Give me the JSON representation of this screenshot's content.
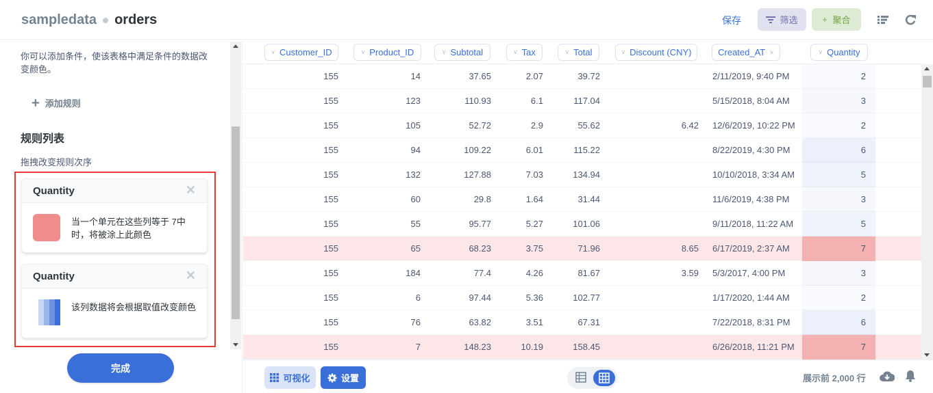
{
  "header": {
    "database": "sampledata",
    "table": "orders",
    "save_label": "保存",
    "filter_label": "筛选",
    "aggregate_label": "聚合",
    "icons": [
      "filter-icon",
      "plus-icon",
      "list-icon",
      "refresh-icon"
    ]
  },
  "sidebar": {
    "description": "你可以添加条件，使该表格中满足条件的数据改变颜色。",
    "add_rule_label": "添加规则",
    "rules_title": "规则列表",
    "rules_subtitle": "拖拽改变规则次序",
    "rules": [
      {
        "column": "Quantity",
        "type": "single",
        "color": "#ef8c8c",
        "text": "当一个单元在这些列等于 7中时，将被涂上此颜色"
      },
      {
        "column": "Quantity",
        "type": "range",
        "colors": [
          "#ffffff",
          "#c8d6f3",
          "#9db6ea",
          "#6e92df",
          "#3a6fd9"
        ],
        "text": "该列数据将会根据取值改变颜色"
      }
    ],
    "done_label": "完成"
  },
  "table": {
    "columns": [
      {
        "key": "customer_id",
        "label": "Customer_ID"
      },
      {
        "key": "product_id",
        "label": "Product_ID"
      },
      {
        "key": "subtotal",
        "label": "Subtotal"
      },
      {
        "key": "tax",
        "label": "Tax"
      },
      {
        "key": "total",
        "label": "Total"
      },
      {
        "key": "discount",
        "label": "Discount (CNY)"
      },
      {
        "key": "created_at",
        "label": "Created_AT"
      },
      {
        "key": "quantity",
        "label": "Quantity"
      }
    ],
    "highlight_color": "#fce6e7",
    "highlight_cell_color": "#f3b1b2",
    "rows": [
      [
        "155",
        "14",
        "37.65",
        "2.07",
        "39.72",
        "",
        "2/11/2019, 9:40 PM",
        "2"
      ],
      [
        "155",
        "123",
        "110.93",
        "6.1",
        "117.04",
        "",
        "5/15/2018, 8:04 AM",
        "3"
      ],
      [
        "155",
        "105",
        "52.72",
        "2.9",
        "55.62",
        "6.42",
        "12/6/2019, 10:22 PM",
        "2"
      ],
      [
        "155",
        "94",
        "109.22",
        "6.01",
        "115.22",
        "",
        "8/22/2019, 4:30 PM",
        "6"
      ],
      [
        "155",
        "132",
        "127.88",
        "7.03",
        "134.94",
        "",
        "10/10/2018, 3:34 AM",
        "5"
      ],
      [
        "155",
        "60",
        "29.8",
        "1.64",
        "31.44",
        "",
        "11/6/2019, 4:38 PM",
        "3"
      ],
      [
        "155",
        "55",
        "95.77",
        "5.27",
        "101.06",
        "",
        "9/11/2018, 11:22 AM",
        "5"
      ],
      [
        "155",
        "65",
        "68.23",
        "3.75",
        "71.96",
        "8.65",
        "6/17/2019, 2:37 AM",
        "7"
      ],
      [
        "155",
        "184",
        "77.4",
        "4.26",
        "81.67",
        "3.59",
        "5/3/2017, 4:00 PM",
        "3"
      ],
      [
        "155",
        "6",
        "97.44",
        "5.36",
        "102.77",
        "",
        "1/17/2020, 1:44 AM",
        "2"
      ],
      [
        "155",
        "76",
        "63.82",
        "3.51",
        "67.31",
        "",
        "7/22/2018, 8:31 PM",
        "6"
      ],
      [
        "155",
        "7",
        "148.23",
        "10.19",
        "158.45",
        "",
        "6/26/2018, 11:21 PM",
        "7"
      ]
    ]
  },
  "footer": {
    "visualize_label": "可视化",
    "settings_label": "设置",
    "row_count": "展示前 2,000 行",
    "view_mode": "table"
  }
}
